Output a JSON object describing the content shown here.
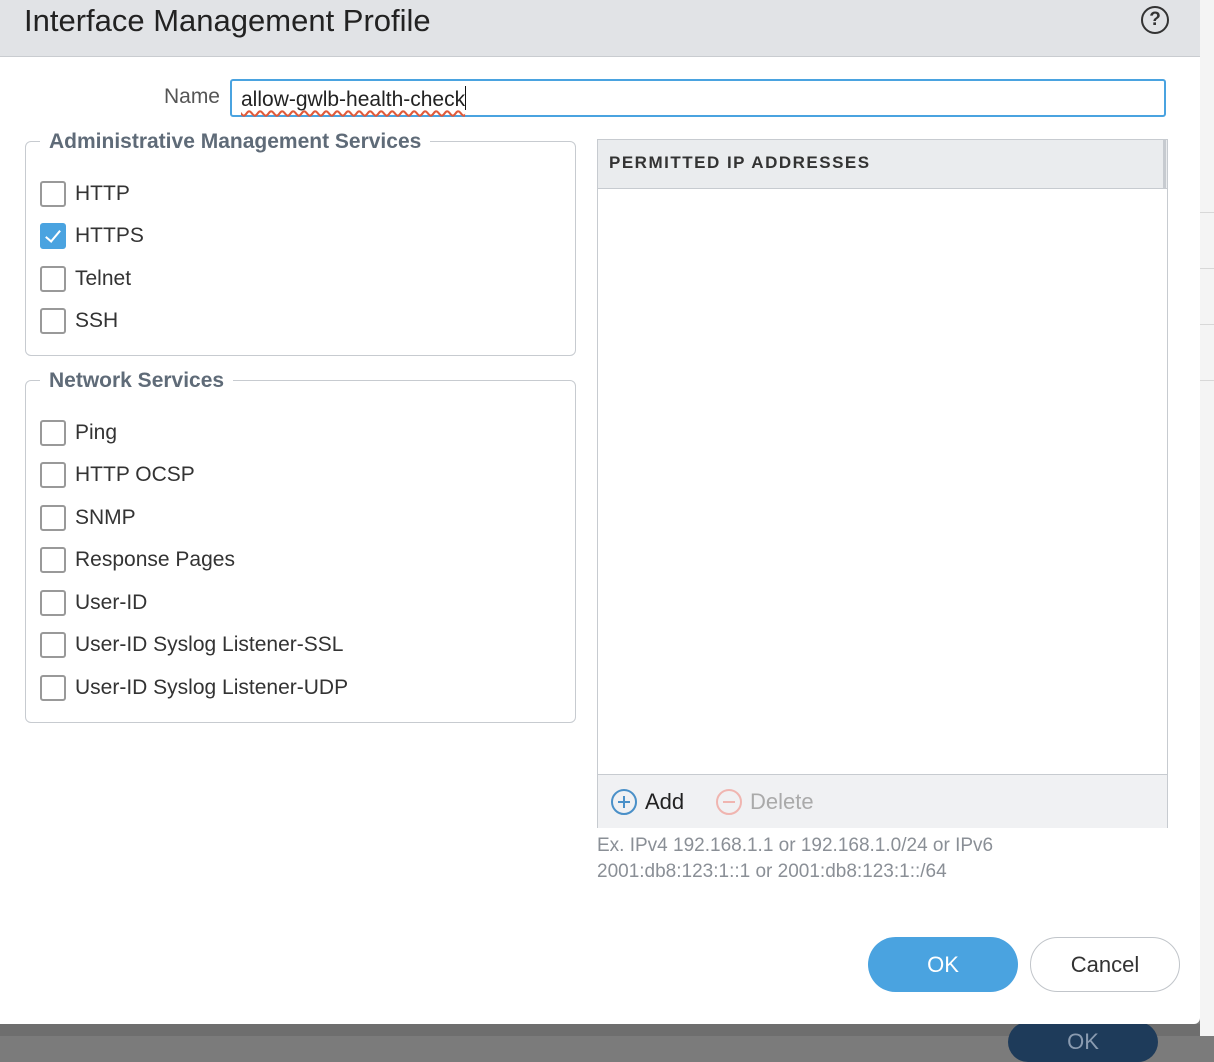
{
  "dialog": {
    "title": "Interface Management Profile",
    "help_icon": "help-circle-icon",
    "help_glyph": "?"
  },
  "name_field": {
    "label": "Name",
    "value": "allow-gwlb-health-check"
  },
  "admin_services": {
    "legend": "Administrative Management Services",
    "items": [
      {
        "label": "HTTP",
        "checked": false
      },
      {
        "label": "HTTPS",
        "checked": true
      },
      {
        "label": "Telnet",
        "checked": false
      },
      {
        "label": "SSH",
        "checked": false
      }
    ]
  },
  "network_services": {
    "legend": "Network Services",
    "items": [
      {
        "label": "Ping",
        "checked": false
      },
      {
        "label": "HTTP OCSP",
        "checked": false
      },
      {
        "label": "SNMP",
        "checked": false
      },
      {
        "label": "Response Pages",
        "checked": false
      },
      {
        "label": "User-ID",
        "checked": false
      },
      {
        "label": "User-ID Syslog Listener-SSL",
        "checked": false
      },
      {
        "label": "User-ID Syslog Listener-UDP",
        "checked": false
      }
    ]
  },
  "permitted_ips": {
    "column_header": "PERMITTED IP ADDRESSES",
    "add_label": "Add",
    "delete_label": "Delete",
    "add_icon": "plus-circle-icon",
    "delete_icon": "minus-circle-icon",
    "hint": "Ex. IPv4 192.168.1.1 or 192.168.1.0/24 or IPv6 2001:db8:123:1::1 or 2001:db8:123:1::/64"
  },
  "actions": {
    "ok_label": "OK",
    "cancel_label": "Cancel"
  },
  "background": {
    "ok_label": "OK"
  },
  "colors": {
    "accent": "#4aa3e0",
    "titlebar": "#e1e3e6",
    "legend_text": "#5f6b78",
    "delete_disabled": "#f0b5b0"
  }
}
